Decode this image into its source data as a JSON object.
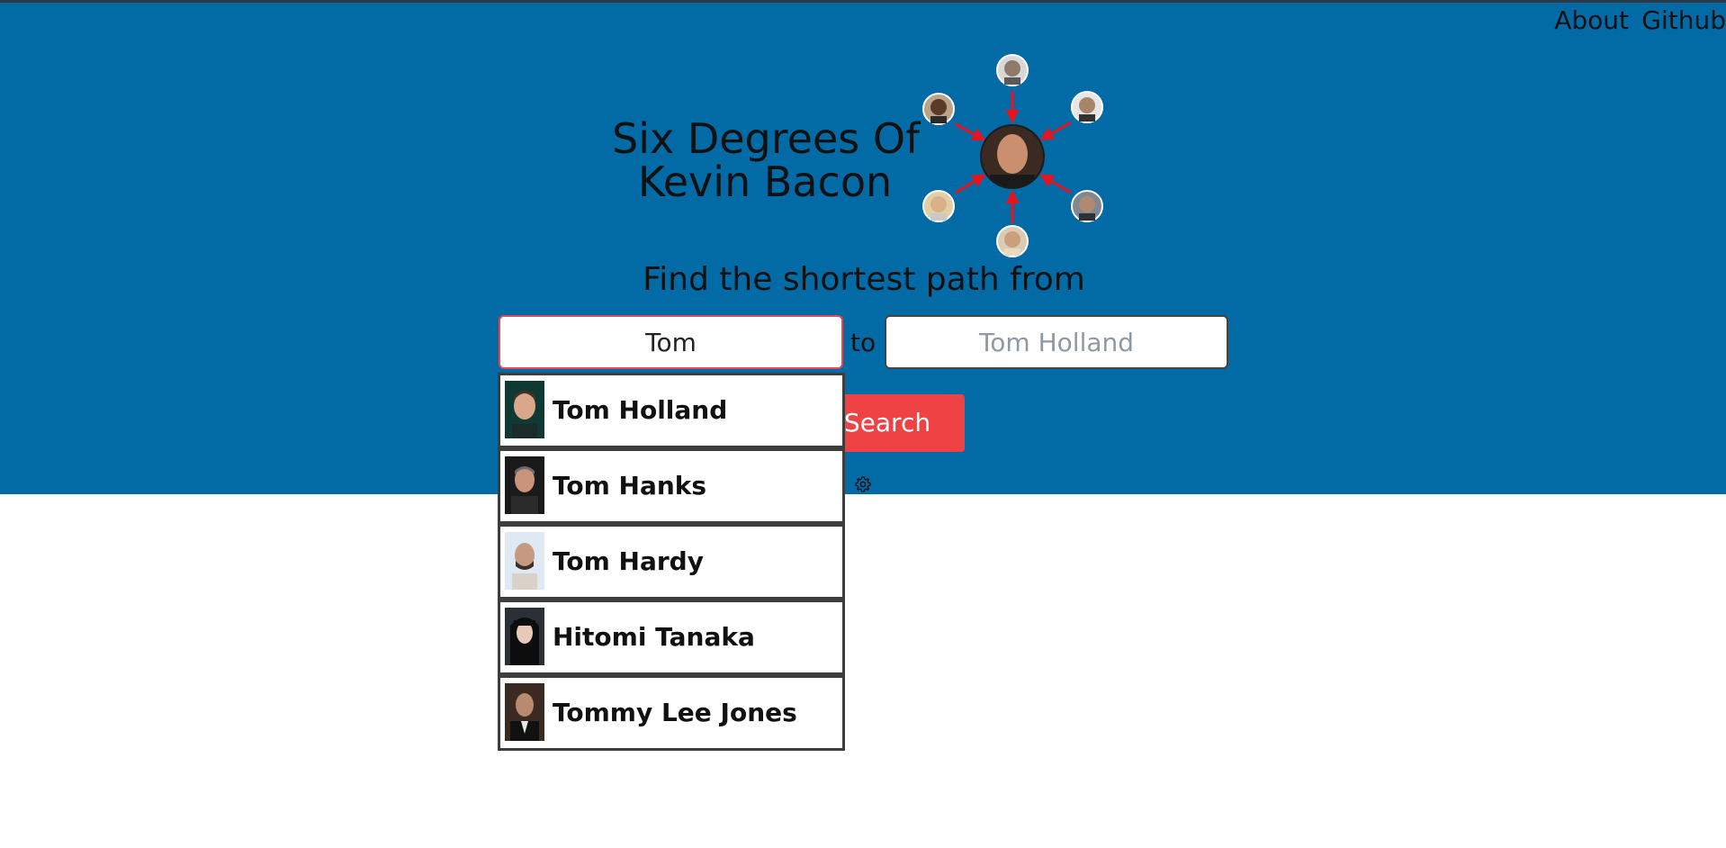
{
  "nav": {
    "about": "About",
    "github": "Github"
  },
  "header": {
    "title_line1": "Six Degrees Of",
    "title_line2": "Kevin Bacon"
  },
  "search": {
    "subtitle": "Find the shortest path from",
    "from_value": "Tom",
    "to_label": "to",
    "to_placeholder": "Tom Holland",
    "button_label": "Search"
  },
  "suggestions": [
    {
      "name": "Tom Holland"
    },
    {
      "name": "Tom Hanks"
    },
    {
      "name": "Tom Hardy"
    },
    {
      "name": "Hitomi Tanaka"
    },
    {
      "name": "Tommy Lee Jones"
    }
  ],
  "colors": {
    "hero_bg": "#026aa5",
    "accent_red": "#ee4245",
    "arrow_red": "#e8131d",
    "focus_border": "#e04a57"
  },
  "icons": [
    "kevin-bacon-avatar",
    "actor-avatar",
    "settings-gear-icon"
  ]
}
